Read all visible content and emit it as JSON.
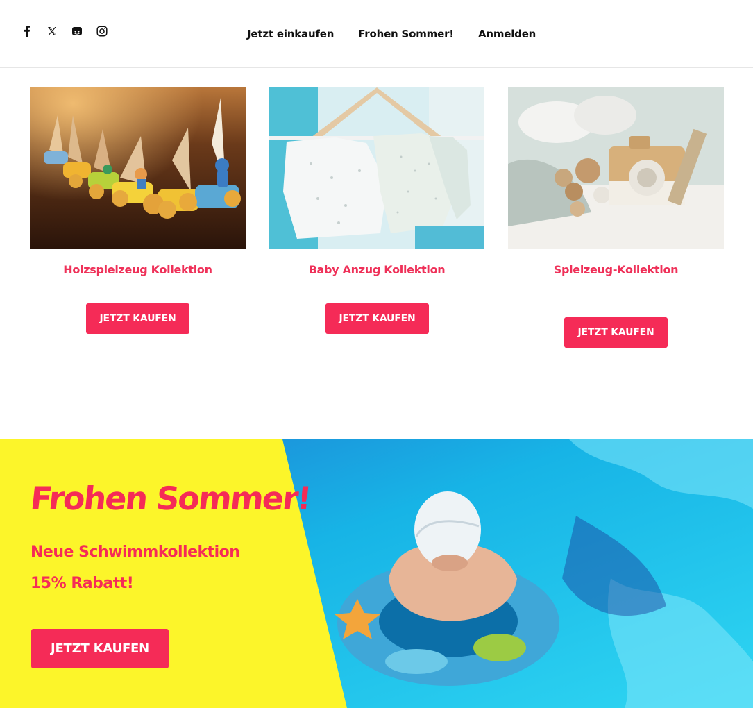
{
  "header": {
    "social": [
      {
        "icon": "facebook-icon"
      },
      {
        "icon": "x-twitter-icon"
      },
      {
        "icon": "discord-icon"
      },
      {
        "icon": "instagram-icon"
      }
    ],
    "nav": [
      "Jetzt einkaufen",
      "Frohen Sommer!",
      "Anmelden"
    ]
  },
  "collections": [
    {
      "title": "Holzspielzeug Kollektion",
      "button": "JETZT KAUFEN"
    },
    {
      "title": "Baby Anzug Kollektion",
      "button": "JETZT KAUFEN"
    },
    {
      "title": "Spielzeug-Kollektion",
      "button": "JETZT KAUFEN"
    }
  ],
  "banner": {
    "headline": "Frohen Sommer!",
    "line1": "Neue Schwimmkollektion",
    "line2": "15% Rabatt!",
    "button": "JETZT KAUFEN"
  },
  "colors": {
    "accent": "#f52b57",
    "banner_yellow": "#fcf52a",
    "pool_blue": "#1ec3ee"
  }
}
